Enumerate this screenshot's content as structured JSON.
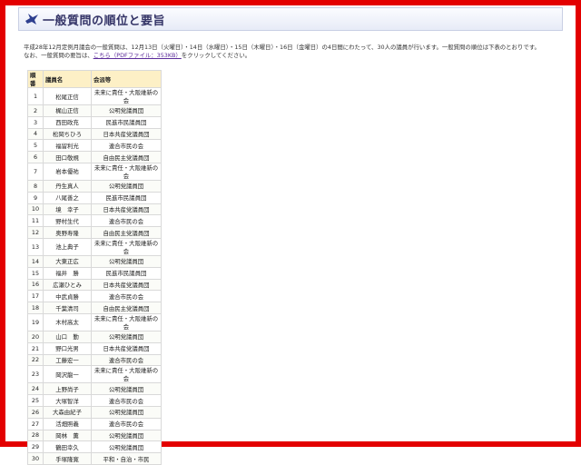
{
  "page": {
    "title": "一般質問の順位と要旨",
    "intro_line1": "平成28年12月定例月議会の一般質問は、12月13日（火曜日）・14日（水曜日）・15日（木曜日）・16日（金曜日）の4日間にわたって、30人の議員が行います。一般質問の順位は下表のとおりです。",
    "intro_line2_prefix": "なお、一般質問の要旨は、",
    "intro_link": "こちら（PDFファイル：353KB）",
    "intro_line2_suffix": "をクリックしてください。"
  },
  "table": {
    "headers": {
      "no": "順番",
      "name": "議員名",
      "group": "会派等"
    },
    "rows": [
      {
        "no": "1",
        "name": "松尾正信",
        "group": "未来に責任・大阪維新の会"
      },
      {
        "no": "2",
        "name": "梶山正信",
        "group": "公明党議員団"
      },
      {
        "no": "3",
        "name": "西田政充",
        "group": "民進市民議員団"
      },
      {
        "no": "4",
        "name": "松岡ちひろ",
        "group": "日本共産党議員団"
      },
      {
        "no": "5",
        "name": "福留利光",
        "group": "連合市民の会"
      },
      {
        "no": "6",
        "name": "田口敬規",
        "group": "自由民主党議員団"
      },
      {
        "no": "7",
        "name": "岩本優祐",
        "group": "未来に責任・大阪維新の会"
      },
      {
        "no": "8",
        "name": "丹生真人",
        "group": "公明党議員団"
      },
      {
        "no": "9",
        "name": "八尾善之",
        "group": "民進市民議員団"
      },
      {
        "no": "10",
        "name": "境　幸子",
        "group": "日本共産党議員団"
      },
      {
        "no": "11",
        "name": "野村生代",
        "group": "連合市民の会"
      },
      {
        "no": "12",
        "name": "奥野寿隆",
        "group": "自由民主党議員団"
      },
      {
        "no": "13",
        "name": "池上典子",
        "group": "未来に責任・大阪維新の会"
      },
      {
        "no": "14",
        "name": "大東正広",
        "group": "公明党議員団"
      },
      {
        "no": "15",
        "name": "福井　勝",
        "group": "民進市民議員団"
      },
      {
        "no": "16",
        "name": "広瀬ひとみ",
        "group": "日本共産党議員団"
      },
      {
        "no": "17",
        "name": "中武貞勝",
        "group": "連合市民の会"
      },
      {
        "no": "18",
        "name": "千葉清司",
        "group": "自由民主党議員団"
      },
      {
        "no": "19",
        "name": "木村高太",
        "group": "未来に責任・大阪維新の会"
      },
      {
        "no": "20",
        "name": "山口　勤",
        "group": "公明党議員団"
      },
      {
        "no": "21",
        "name": "野口光男",
        "group": "日本共産党議員団"
      },
      {
        "no": "22",
        "name": "工藤宏一",
        "group": "連合市民の会"
      },
      {
        "no": "23",
        "name": "岡沢龍一",
        "group": "未来に責任・大阪維新の会"
      },
      {
        "no": "24",
        "name": "上野尚子",
        "group": "公明党議員団"
      },
      {
        "no": "25",
        "name": "大塚智洋",
        "group": "連合市民の会"
      },
      {
        "no": "26",
        "name": "大森由紀子",
        "group": "公明党議員団"
      },
      {
        "no": "27",
        "name": "活畑照義",
        "group": "連合市民の会"
      },
      {
        "no": "28",
        "name": "岡林　薫",
        "group": "公明党議員団"
      },
      {
        "no": "29",
        "name": "鶴田幸久",
        "group": "公明党議員団"
      },
      {
        "no": "30",
        "name": "手塚隆寛",
        "group": "平和・自治・市民"
      }
    ]
  }
}
